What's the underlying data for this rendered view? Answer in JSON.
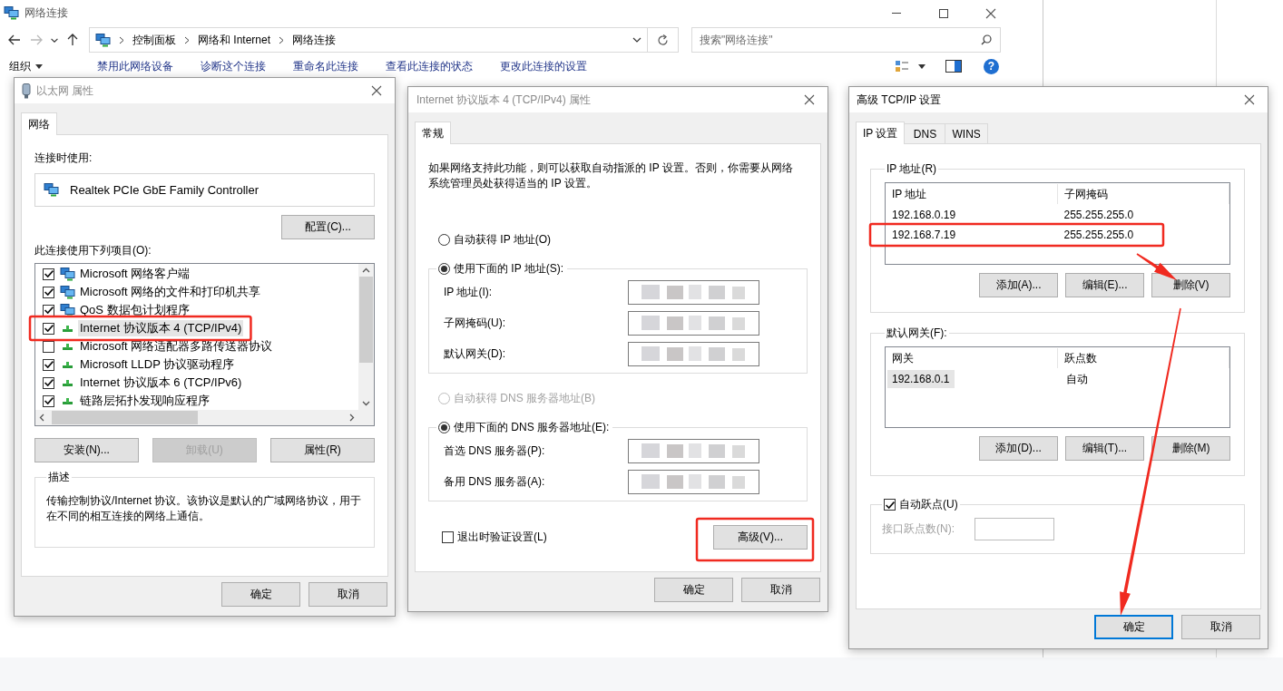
{
  "explorer": {
    "title": "网络连接",
    "breadcrumbs": [
      "控制面板",
      "网络和 Internet",
      "网络连接"
    ],
    "search_placeholder": "搜索\"网络连接\"",
    "toolbar": [
      {
        "label": "组织",
        "kind": "menu"
      },
      {
        "label": "禁用此网络设备",
        "kind": "action"
      },
      {
        "label": "诊断这个连接",
        "kind": "action"
      },
      {
        "label": "重命名此连接",
        "kind": "action"
      },
      {
        "label": "查看此连接的状态",
        "kind": "action"
      },
      {
        "label": "更改此连接的设置",
        "kind": "action"
      }
    ],
    "help_glyph": "?"
  },
  "ethernet_dialog": {
    "title": "以太网 属性",
    "tabs": [
      {
        "label": "网络",
        "selected": true
      }
    ],
    "connect_using_label": "连接时使用:",
    "adapter": "Realtek PCIe GbE Family Controller",
    "configure_button": "配置(C)...",
    "items_label": "此连接使用下列项目(O):",
    "items": [
      {
        "label": "Microsoft 网络客户端",
        "kind": "client",
        "checked": true,
        "selected": false,
        "annotated": false
      },
      {
        "label": "Microsoft 网络的文件和打印机共享",
        "kind": "service",
        "checked": true,
        "selected": false,
        "annotated": false
      },
      {
        "label": "QoS 数据包计划程序",
        "kind": "service",
        "checked": true,
        "selected": false,
        "annotated": false
      },
      {
        "label": "Internet 协议版本 4 (TCP/IPv4)",
        "kind": "protocol",
        "checked": true,
        "selected": true,
        "annotated": true
      },
      {
        "label": "Microsoft 网络适配器多路传送器协议",
        "kind": "protocol",
        "checked": false,
        "selected": false,
        "annotated": false
      },
      {
        "label": "Microsoft LLDP 协议驱动程序",
        "kind": "protocol",
        "checked": true,
        "selected": false,
        "annotated": false
      },
      {
        "label": "Internet 协议版本 6 (TCP/IPv6)",
        "kind": "protocol",
        "checked": true,
        "selected": false,
        "annotated": false
      },
      {
        "label": "链路层拓扑发现响应程序",
        "kind": "protocol",
        "checked": true,
        "selected": false,
        "annotated": false
      }
    ],
    "buttons": [
      {
        "label": "安装(N)...",
        "disabled": false
      },
      {
        "label": "卸载(U)",
        "disabled": true
      },
      {
        "label": "属性(R)",
        "disabled": false
      }
    ],
    "description_title": "描述",
    "description": "传输控制协议/Internet 协议。该协议是默认的广域网络协议，用于在不同的相互连接的网络上通信。",
    "footer_buttons": [
      "确定",
      "取消"
    ]
  },
  "ipv4_dialog": {
    "title": "Internet 协议版本 4 (TCP/IPv4) 属性",
    "tabs": [
      {
        "label": "常规",
        "selected": true
      }
    ],
    "intro": "如果网络支持此功能，则可以获取自动指派的 IP 设置。否则，你需要从网络系统管理员处获得适当的 IP 设置。",
    "ip_modes": [
      {
        "label": "自动获得 IP 地址(O)",
        "selected": false,
        "disabled": false
      },
      {
        "label": "使用下面的 IP 地址(S):",
        "selected": true,
        "disabled": false
      }
    ],
    "ip_fields": [
      {
        "label": "IP 地址(I):",
        "redacted": true
      },
      {
        "label": "子网掩码(U):",
        "redacted": true
      },
      {
        "label": "默认网关(D):",
        "redacted": true
      }
    ],
    "dns_modes": [
      {
        "label": "自动获得 DNS 服务器地址(B)",
        "selected": false,
        "disabled": true
      },
      {
        "label": "使用下面的 DNS 服务器地址(E):",
        "selected": true,
        "disabled": false
      }
    ],
    "dns_fields": [
      {
        "label": "首选 DNS 服务器(P):",
        "redacted": true
      },
      {
        "label": "备用 DNS 服务器(A):",
        "redacted": true
      }
    ],
    "validate": {
      "label": "退出时验证设置(L)",
      "checked": false
    },
    "advanced_button": {
      "label": "高级(V)...",
      "annotated": true
    },
    "footer_buttons": [
      "确定",
      "取消"
    ]
  },
  "advanced_dialog": {
    "title": "高级 TCP/IP 设置",
    "tabs": [
      {
        "label": "IP 设置",
        "selected": true
      },
      {
        "label": "DNS",
        "selected": false
      },
      {
        "label": "WINS",
        "selected": false
      }
    ],
    "ip_group": {
      "title": "IP 地址(R)",
      "columns": [
        "IP 地址",
        "子网掩码"
      ],
      "rows": [
        {
          "cells": [
            "192.168.0.19",
            "255.255.255.0"
          ],
          "annotated": false
        },
        {
          "cells": [
            "192.168.7.19",
            "255.255.255.0"
          ],
          "annotated": true
        }
      ],
      "buttons": [
        "添加(A)...",
        "编辑(E)...",
        "删除(V)"
      ]
    },
    "gateway_group": {
      "title": "默认网关(F):",
      "columns": [
        "网关",
        "跃点数"
      ],
      "rows": [
        {
          "cells": [
            "192.168.0.1",
            "自动"
          ],
          "selected": true
        }
      ],
      "buttons": [
        "添加(D)...",
        "编辑(T)...",
        "删除(M)"
      ]
    },
    "auto_metric": {
      "label": "自动跃点(U)",
      "checked": true
    },
    "metric_field": {
      "label": "接口跃点数(N):",
      "disabled": true
    },
    "footer_buttons": [
      {
        "label": "确定",
        "focused": true
      },
      {
        "label": "取消",
        "focused": false
      }
    ]
  }
}
